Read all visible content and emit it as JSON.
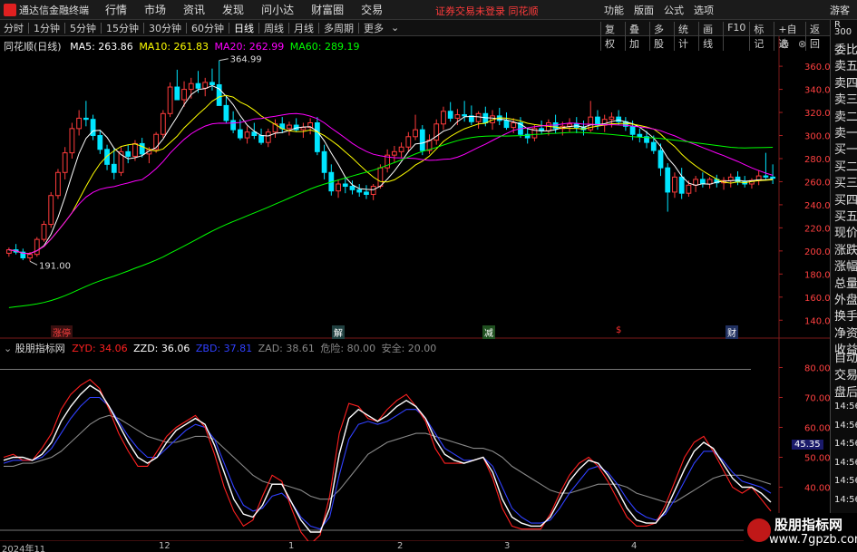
{
  "menubar": {
    "app_title": "通达信金融终端",
    "items": [
      "行情",
      "市场",
      "资讯",
      "发现",
      "问小达",
      "财富圈",
      "交易"
    ],
    "alert": "证券交易未登录  同花顺",
    "right_items": [
      "功能",
      "版面",
      "公式",
      "选项"
    ],
    "guest": "游客"
  },
  "toolbar": {
    "periods": [
      "分时",
      "1分钟",
      "5分钟",
      "15分钟",
      "30分钟",
      "60分钟",
      "日线",
      "周线",
      "月线",
      "多周期",
      "更多"
    ],
    "active_period": "日线",
    "right_items": [
      "复权",
      "叠加",
      "多股",
      "统计",
      "画线",
      "F10",
      "标记",
      "+自选",
      "返回"
    ]
  },
  "main_legend": {
    "title": "同花顺(日线)",
    "ma5": "MA5: 263.86",
    "ma10": "MA10: 261.83",
    "ma20": "MA20: 262.99",
    "ma60": "MA60: 289.19"
  },
  "main_annotations": {
    "high_label": "364.99",
    "low_label": "191.00"
  },
  "event_tags": [
    "涨停",
    "解",
    "减",
    "$",
    "财"
  ],
  "indicator_legend": {
    "name": "股朋指标网",
    "zyd": "ZYD: 34.06",
    "zzd": "ZZD: 36.06",
    "zbd": "ZBD: 37.81",
    "zad": "ZAD: 38.61",
    "danger": "危险: 80.00",
    "safe": "安全: 20.00",
    "current_value": "45.35"
  },
  "price_axis": [
    "360.00",
    "340.00",
    "320.00",
    "300.00",
    "280.00",
    "260.00",
    "240.00",
    "220.00",
    "200.00",
    "180.00",
    "160.00",
    "140.00"
  ],
  "indicator_axis": [
    "80.00",
    "70.00",
    "60.00",
    "50.00",
    "40.00",
    "30.00"
  ],
  "side_tabs": [
    "委比",
    "卖五",
    "卖四",
    "卖三",
    "卖二",
    "卖一",
    "买一",
    "买二",
    "买三",
    "买四",
    "买五",
    "现价",
    "涨跌",
    "涨幅",
    "总量",
    "外盘",
    "换手",
    "净资",
    "收益"
  ],
  "side_lower": [
    "自动",
    "交易",
    "盘后"
  ],
  "side_times": [
    "14:56",
    "14:56",
    "14:56",
    "14:56",
    "14:56",
    "14:56",
    "14:56"
  ],
  "side_top_small": [
    "R",
    "300"
  ],
  "time_axis": [
    "2024年11",
    "12",
    "1",
    "2",
    "3",
    "4"
  ],
  "brand": {
    "line1": "股朋指标网",
    "line2": "www.7gpzb.com"
  },
  "colors": {
    "up": "#ff3c3c",
    "down": "#00e5ff",
    "ma5": "#ffffff",
    "ma10": "#ffff00",
    "ma20": "#ff00ff",
    "ma60": "#00ff00",
    "zyd": "#ff2020",
    "zzd": "#ffffff",
    "zbd": "#3040ff",
    "zad": "#888888"
  },
  "chart_data": [
    {
      "type": "candlestick",
      "title": "同花顺(日线)",
      "ylim": [
        130,
        375
      ],
      "yticks": [
        360,
        340,
        320,
        300,
        280,
        260,
        240,
        220,
        200,
        180,
        160,
        140
      ],
      "ohlc": [
        [
          198,
          203,
          195,
          201
        ],
        [
          201,
          206,
          197,
          199
        ],
        [
          199,
          202,
          192,
          194
        ],
        [
          194,
          199,
          191,
          197
        ],
        [
          197,
          212,
          195,
          210
        ],
        [
          210,
          226,
          208,
          223
        ],
        [
          223,
          251,
          220,
          248
        ],
        [
          248,
          271,
          245,
          268
        ],
        [
          268,
          290,
          262,
          285
        ],
        [
          285,
          311,
          280,
          306
        ],
        [
          306,
          322,
          300,
          315
        ],
        [
          315,
          330,
          308,
          314
        ],
        [
          314,
          318,
          296,
          300
        ],
        [
          300,
          304,
          284,
          288
        ],
        [
          288,
          292,
          270,
          275
        ],
        [
          275,
          289,
          262,
          268
        ],
        [
          268,
          290,
          265,
          286
        ],
        [
          286,
          292,
          276,
          282
        ],
        [
          282,
          296,
          278,
          293
        ],
        [
          293,
          298,
          281,
          284
        ],
        [
          284,
          290,
          276,
          288
        ],
        [
          288,
          303,
          285,
          301
        ],
        [
          301,
          322,
          298,
          319
        ],
        [
          319,
          346,
          316,
          342
        ],
        [
          342,
          357,
          336,
          331
        ],
        [
          331,
          347,
          325,
          340
        ],
        [
          340,
          350,
          332,
          345
        ],
        [
          345,
          356,
          337,
          341
        ],
        [
          341,
          350,
          334,
          346
        ],
        [
          346,
          358,
          339,
          344
        ],
        [
          344,
          365,
          338,
          326
        ],
        [
          326,
          335,
          311,
          313
        ],
        [
          313,
          321,
          302,
          305
        ],
        [
          305,
          314,
          296,
          298
        ],
        [
          298,
          308,
          293,
          303
        ],
        [
          303,
          311,
          297,
          300
        ],
        [
          300,
          306,
          292,
          294
        ],
        [
          294,
          306,
          290,
          303
        ],
        [
          303,
          314,
          298,
          310
        ],
        [
          310,
          316,
          302,
          306
        ],
        [
          306,
          312,
          300,
          309
        ],
        [
          309,
          315,
          303,
          305
        ],
        [
          305,
          311,
          298,
          307
        ],
        [
          307,
          315,
          301,
          311
        ],
        [
          311,
          316,
          283,
          286
        ],
        [
          286,
          292,
          262,
          268
        ],
        [
          268,
          275,
          248,
          252
        ],
        [
          252,
          262,
          246,
          258
        ],
        [
          258,
          264,
          250,
          256
        ],
        [
          256,
          261,
          249,
          253
        ],
        [
          253,
          258,
          247,
          251
        ],
        [
          251,
          257,
          245,
          249
        ],
        [
          249,
          258,
          244,
          256
        ],
        [
          256,
          275,
          254,
          272
        ],
        [
          272,
          288,
          268,
          283
        ],
        [
          283,
          291,
          277,
          286
        ],
        [
          286,
          294,
          281,
          290
        ],
        [
          290,
          303,
          286,
          299
        ],
        [
          299,
          318,
          296,
          305
        ],
        [
          305,
          309,
          283,
          287
        ],
        [
          287,
          301,
          284,
          296
        ],
        [
          296,
          314,
          292,
          310
        ],
        [
          310,
          325,
          305,
          321
        ],
        [
          321,
          329,
          312,
          315
        ],
        [
          315,
          323,
          309,
          318
        ],
        [
          318,
          330,
          312,
          317
        ],
        [
          317,
          326,
          309,
          312
        ],
        [
          312,
          321,
          306,
          319
        ],
        [
          319,
          325,
          308,
          311
        ],
        [
          311,
          322,
          305,
          317
        ],
        [
          317,
          324,
          309,
          313
        ],
        [
          313,
          320,
          305,
          307
        ],
        [
          307,
          315,
          302,
          311
        ],
        [
          311,
          316,
          298,
          301
        ],
        [
          301,
          306,
          293,
          298
        ],
        [
          298,
          309,
          295,
          306
        ],
        [
          306,
          313,
          301,
          304
        ],
        [
          304,
          314,
          300,
          311
        ],
        [
          311,
          318,
          302,
          306
        ],
        [
          306,
          312,
          300,
          308
        ],
        [
          308,
          315,
          303,
          310
        ],
        [
          310,
          316,
          302,
          307
        ],
        [
          307,
          313,
          300,
          305
        ],
        [
          305,
          330,
          303,
          316
        ],
        [
          316,
          322,
          305,
          309
        ],
        [
          309,
          318,
          303,
          314
        ],
        [
          314,
          320,
          307,
          316
        ],
        [
          316,
          322,
          309,
          312
        ],
        [
          312,
          316,
          304,
          308
        ],
        [
          308,
          313,
          296,
          301
        ],
        [
          301,
          306,
          294,
          299
        ],
        [
          299,
          304,
          289,
          294
        ],
        [
          294,
          300,
          284,
          287
        ],
        [
          287,
          293,
          265,
          272
        ],
        [
          272,
          276,
          234,
          251
        ],
        [
          251,
          268,
          246,
          264
        ],
        [
          264,
          272,
          245,
          250
        ],
        [
          250,
          261,
          247,
          257
        ],
        [
          257,
          265,
          251,
          262
        ],
        [
          262,
          268,
          255,
          258
        ],
        [
          258,
          264,
          254,
          262
        ],
        [
          262,
          266,
          255,
          259
        ],
        [
          259,
          264,
          253,
          261
        ],
        [
          261,
          267,
          255,
          264
        ],
        [
          264,
          269,
          257,
          260
        ],
        [
          260,
          265,
          255,
          258
        ],
        [
          258,
          263,
          254,
          261
        ],
        [
          261,
          270,
          257,
          265
        ],
        [
          265,
          285,
          262,
          264
        ],
        [
          264,
          275,
          258,
          263
        ]
      ],
      "annotations": {
        "high": 364.99,
        "low": 191.0
      }
    },
    {
      "type": "line",
      "title": "股朋指标网",
      "ylim": [
        25,
        85
      ],
      "yticks": [
        80,
        70,
        60,
        50,
        40,
        30
      ],
      "reference_lines": {
        "危险": 80.0,
        "安全": 20.0
      },
      "series": [
        {
          "name": "ZYD",
          "values": [
            50,
            51,
            49,
            49,
            53,
            58,
            66,
            71,
            74,
            76,
            73,
            66,
            58,
            52,
            47,
            47,
            52,
            57,
            60,
            62,
            64,
            60,
            51,
            40,
            32,
            27,
            29,
            37,
            44,
            42,
            33,
            25,
            21,
            24,
            37,
            58,
            68,
            67,
            63,
            62,
            66,
            69,
            71,
            67,
            62,
            53,
            48,
            48,
            48,
            49,
            50,
            43,
            33,
            27,
            26,
            26,
            26,
            31,
            38,
            44,
            48,
            50,
            47,
            42,
            36,
            30,
            27,
            27,
            28,
            34,
            42,
            50,
            55,
            57,
            52,
            46,
            40,
            38,
            40,
            36,
            32
          ]
        },
        {
          "name": "ZZD",
          "values": [
            49,
            50,
            50,
            49,
            51,
            55,
            62,
            67,
            71,
            74,
            72,
            67,
            61,
            55,
            50,
            48,
            50,
            55,
            59,
            61,
            63,
            61,
            54,
            45,
            36,
            31,
            30,
            34,
            41,
            41,
            35,
            29,
            25,
            25,
            33,
            51,
            63,
            66,
            64,
            62,
            64,
            67,
            69,
            67,
            63,
            56,
            51,
            49,
            48,
            49,
            50,
            45,
            36,
            30,
            28,
            27,
            27,
            30,
            36,
            42,
            46,
            49,
            48,
            44,
            39,
            33,
            29,
            28,
            28,
            32,
            39,
            46,
            52,
            55,
            53,
            48,
            43,
            40,
            40,
            38,
            35
          ]
        },
        {
          "name": "ZBD",
          "values": [
            48,
            49,
            49,
            49,
            50,
            53,
            58,
            63,
            67,
            70,
            70,
            67,
            62,
            57,
            53,
            50,
            50,
            53,
            56,
            59,
            61,
            60,
            56,
            48,
            40,
            34,
            32,
            33,
            37,
            38,
            35,
            30,
            27,
            26,
            30,
            44,
            56,
            61,
            62,
            61,
            62,
            64,
            66,
            66,
            63,
            58,
            53,
            51,
            49,
            49,
            50,
            47,
            40,
            33,
            30,
            28,
            28,
            29,
            33,
            38,
            42,
            46,
            47,
            45,
            41,
            36,
            32,
            30,
            29,
            31,
            36,
            42,
            48,
            52,
            52,
            49,
            45,
            42,
            41,
            40,
            38
          ]
        },
        {
          "name": "ZAD",
          "values": [
            47,
            47,
            48,
            48,
            49,
            50,
            52,
            55,
            58,
            61,
            63,
            64,
            63,
            61,
            59,
            57,
            56,
            55,
            55,
            56,
            57,
            57,
            56,
            53,
            50,
            47,
            44,
            42,
            41,
            41,
            40,
            39,
            37,
            36,
            36,
            39,
            43,
            47,
            51,
            53,
            55,
            56,
            57,
            58,
            58,
            57,
            56,
            55,
            54,
            53,
            53,
            52,
            50,
            47,
            45,
            43,
            41,
            39,
            38,
            38,
            39,
            40,
            41,
            41,
            41,
            40,
            38,
            37,
            36,
            35,
            35,
            37,
            39,
            41,
            43,
            44,
            44,
            44,
            43,
            42,
            41
          ]
        }
      ]
    }
  ]
}
